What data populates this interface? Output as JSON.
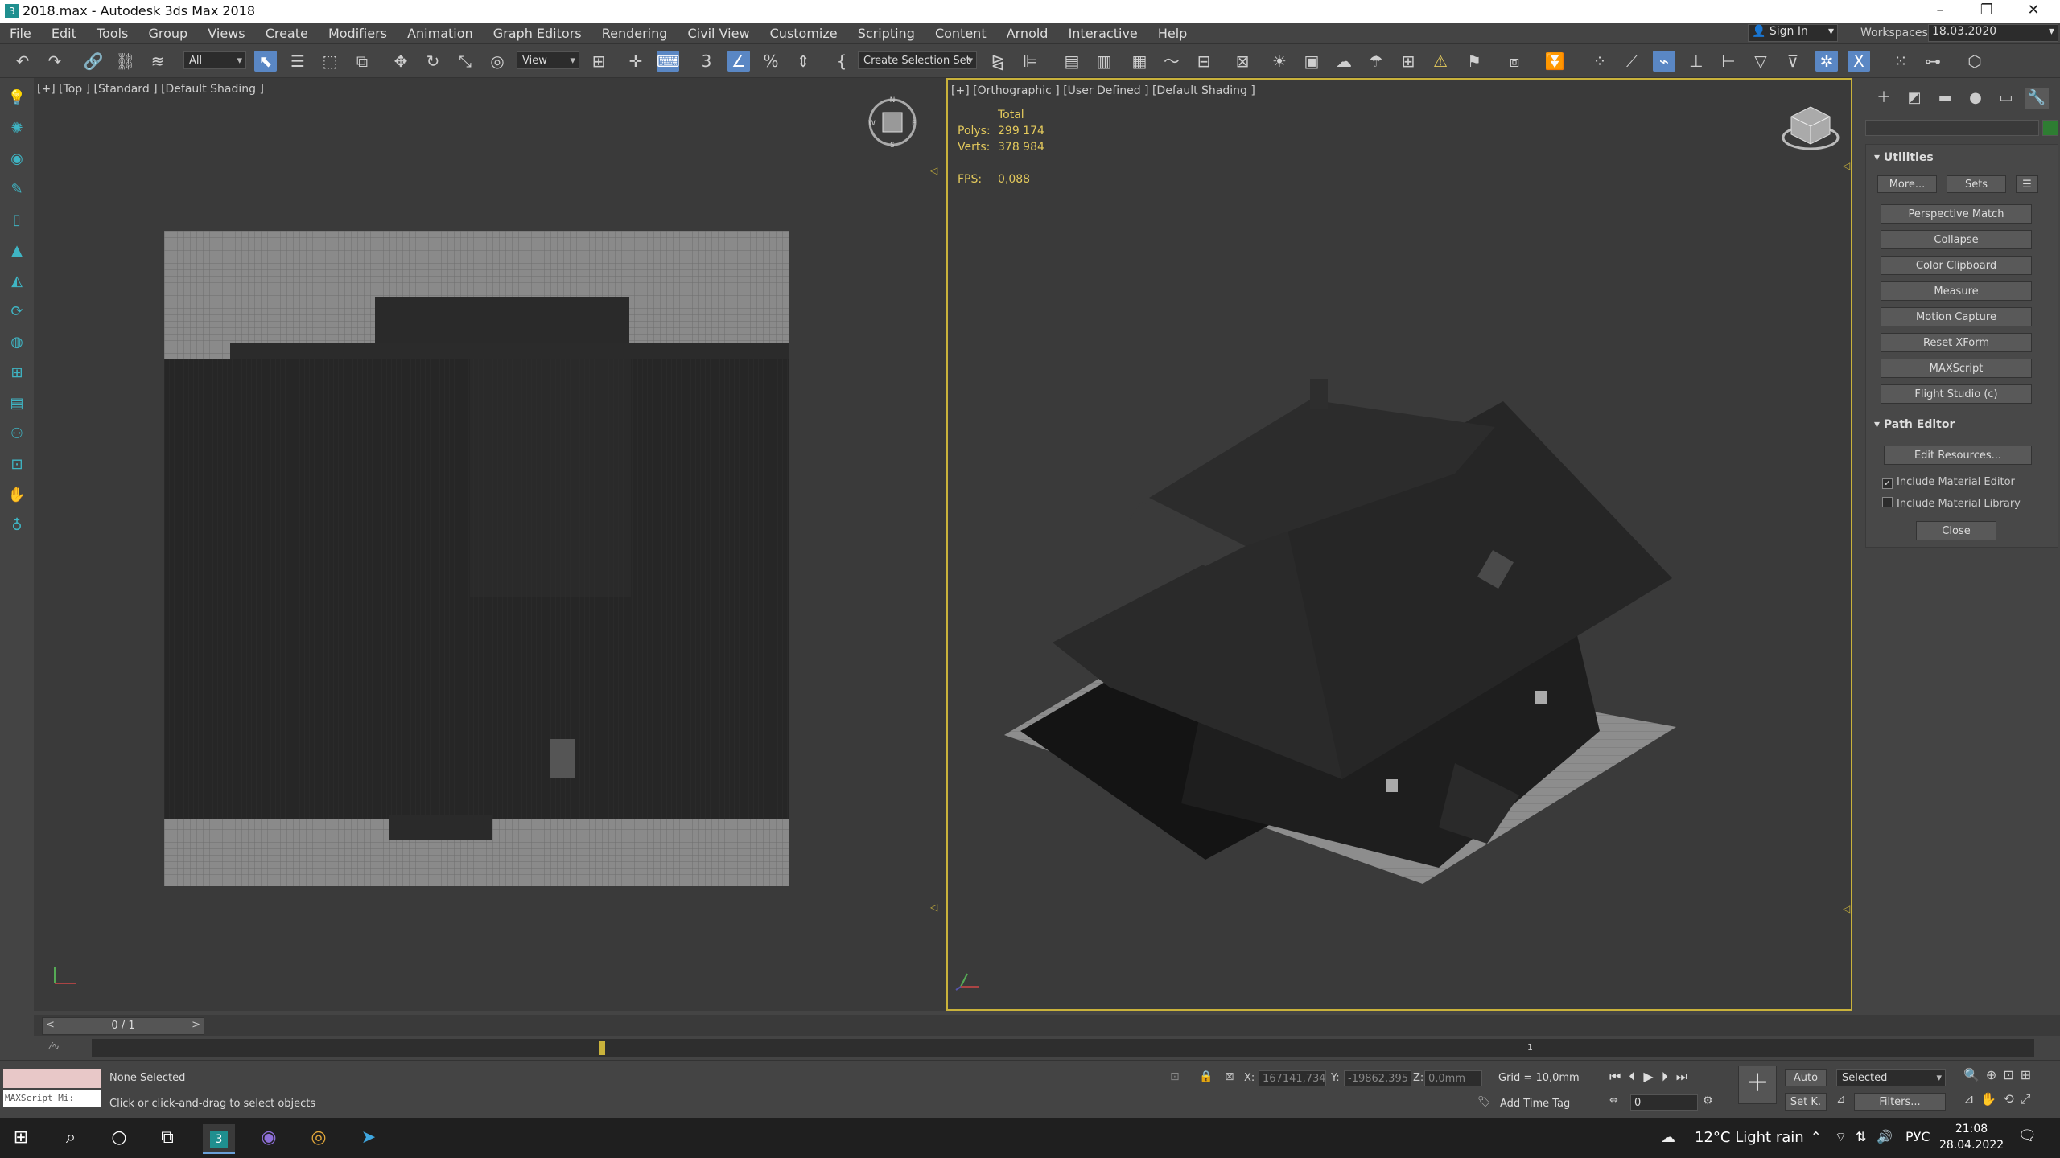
{
  "window": {
    "title": "2018.max - Autodesk 3ds Max 2018",
    "app_icon_letter": "3"
  },
  "menu": [
    "File",
    "Edit",
    "Tools",
    "Group",
    "Views",
    "Create",
    "Modifiers",
    "Animation",
    "Graph Editors",
    "Rendering",
    "Civil View",
    "Customize",
    "Scripting",
    "Content",
    "Arnold",
    "Interactive",
    "Help"
  ],
  "signin": "Sign In",
  "workspaces": {
    "label": "Workspaces:",
    "value": "18.03.2020"
  },
  "toolbar": {
    "filter": "All",
    "ref_coord": "View",
    "selection_set": "Create Selection Set"
  },
  "viewport_left": {
    "label": "[+] [Top ] [Standard ] [Default Shading ]"
  },
  "viewport_right": {
    "label": "[+] [Orthographic ] [User Defined ] [Default Shading ]",
    "stats": {
      "total": "Total",
      "polys_label": "Polys:",
      "polys": "299 174",
      "verts_label": "Verts:",
      "verts": "378 984",
      "fps_label": "FPS:",
      "fps": "0,088"
    }
  },
  "panel": {
    "utilities_title": "Utilities",
    "more": "More...",
    "sets": "Sets",
    "buttons": [
      "Perspective Match",
      "Collapse",
      "Color Clipboard",
      "Measure",
      "Motion Capture",
      "Reset XForm",
      "MAXScript",
      "Flight Studio (c)"
    ],
    "path_editor_title": "Path Editor",
    "edit_resources": "Edit Resources...",
    "include_material_editor": "Include Material Editor",
    "include_material_library": "Include Material Library",
    "close": "Close"
  },
  "timeline": {
    "frame_counter": "0 / 1",
    "marker_label": "1"
  },
  "status": {
    "maxscript_mini": "MAXScript Mi:",
    "selection": "None Selected",
    "prompt": "Click or click-and-drag to select objects",
    "x_label": "X:",
    "x": "167141,734",
    "y_label": "Y:",
    "y": "-19862,395",
    "z_label": "Z:",
    "z": "0,0mm",
    "grid": "Grid = 10,0mm",
    "add_time_tag": "Add Time Tag",
    "auto": "Auto",
    "set_key": "Set K.",
    "key_filter": "Selected",
    "filters": "Filters...",
    "frame": "0"
  },
  "taskbar": {
    "weather": "12°C  Light rain",
    "language": "РУС",
    "time": "21:08",
    "date": "28.04.2022"
  },
  "colors": {
    "accent": "#5a87c4",
    "viewport_border": "#c9b23b",
    "stats_text": "#e3c95c",
    "cmd_icons": "#3fb5c4"
  }
}
